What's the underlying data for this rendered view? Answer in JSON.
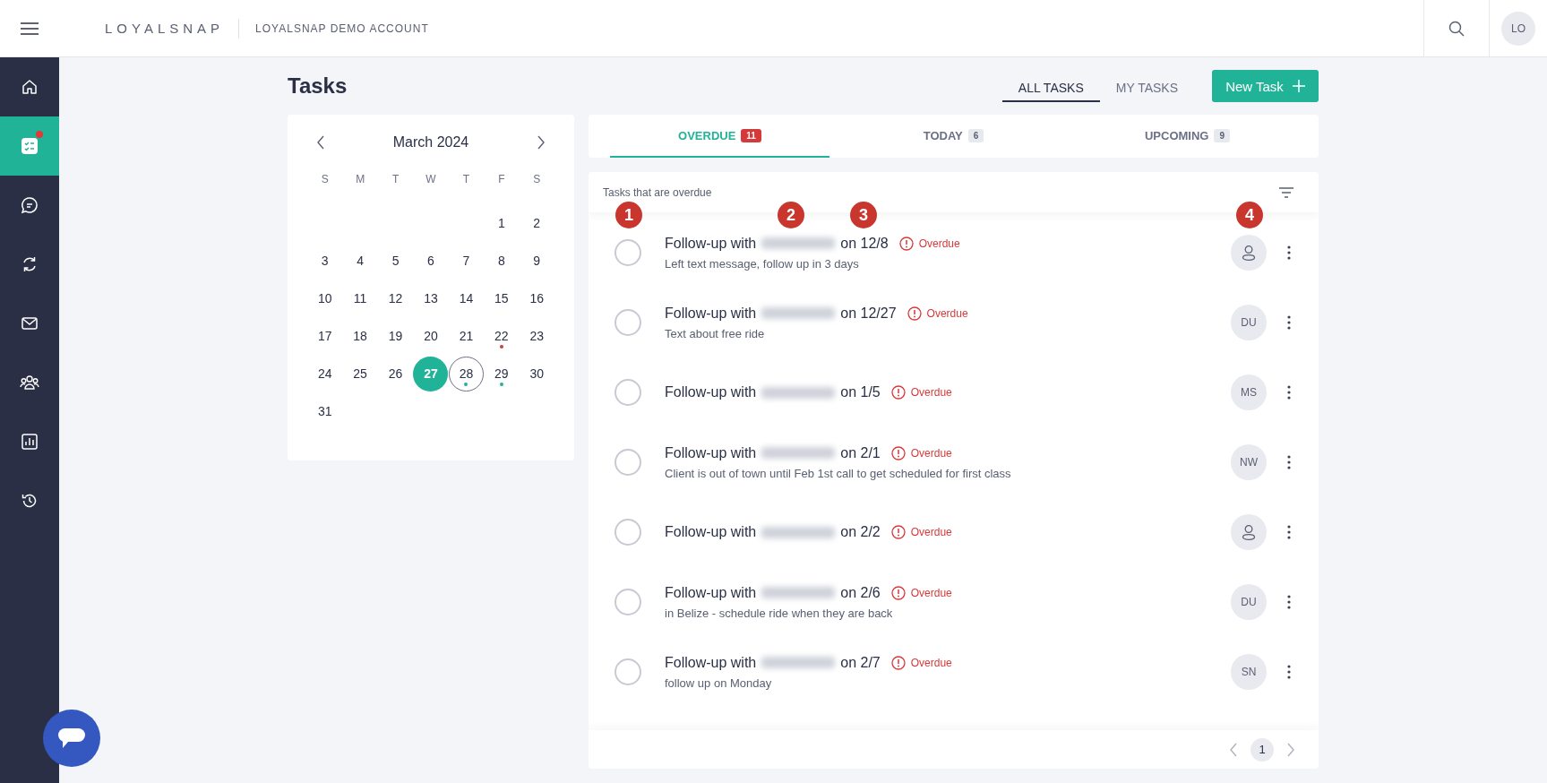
{
  "header": {
    "logo": "LOYALSNAP",
    "account": "LOYALSNAP DEMO ACCOUNT",
    "user_initials": "LO"
  },
  "sidebar": {
    "items": [
      {
        "kind": "home",
        "selected": false,
        "badge": false
      },
      {
        "kind": "tasks",
        "selected": true,
        "badge": true
      },
      {
        "kind": "chat",
        "selected": false,
        "badge": false
      },
      {
        "kind": "sync",
        "selected": false,
        "badge": false
      },
      {
        "kind": "mail",
        "selected": false,
        "badge": false
      },
      {
        "kind": "people",
        "selected": false,
        "badge": false
      },
      {
        "kind": "report",
        "selected": false,
        "badge": false
      },
      {
        "kind": "history",
        "selected": false,
        "badge": false
      }
    ]
  },
  "page": {
    "title": "Tasks"
  },
  "view_tabs": [
    {
      "label": "ALL TASKS",
      "selected": true
    },
    {
      "label": "MY TASKS",
      "selected": false
    }
  ],
  "new_task_button": {
    "label": "New Task"
  },
  "calendar": {
    "month": "March 2024",
    "weekdays": [
      "S",
      "M",
      "T",
      "W",
      "T",
      "F",
      "S"
    ],
    "days": [
      {
        "label": "1",
        "selected": false,
        "today": false
      },
      {
        "label": "2",
        "selected": false,
        "today": false
      },
      {
        "label": "3",
        "selected": false,
        "today": false
      },
      {
        "label": "4",
        "selected": false,
        "today": false
      },
      {
        "label": "5",
        "selected": false,
        "today": false
      },
      {
        "label": "6",
        "selected": false,
        "today": false
      },
      {
        "label": "7",
        "selected": false,
        "today": false
      },
      {
        "label": "8",
        "selected": false,
        "today": false
      },
      {
        "label": "9",
        "selected": false,
        "today": false
      },
      {
        "label": "10",
        "selected": false,
        "today": false
      },
      {
        "label": "11",
        "selected": false,
        "today": false
      },
      {
        "label": "12",
        "selected": false,
        "today": false
      },
      {
        "label": "13",
        "selected": false,
        "today": false
      },
      {
        "label": "14",
        "selected": false,
        "today": false
      },
      {
        "label": "15",
        "selected": false,
        "today": false
      },
      {
        "label": "16",
        "selected": false,
        "today": false
      },
      {
        "label": "17",
        "selected": false,
        "today": false
      },
      {
        "label": "18",
        "selected": false,
        "today": false
      },
      {
        "label": "19",
        "selected": false,
        "today": false
      },
      {
        "label": "20",
        "selected": false,
        "today": false
      },
      {
        "label": "21",
        "selected": false,
        "today": false
      },
      {
        "label": "22",
        "selected": false,
        "today": false,
        "color": "#d6393a"
      },
      {
        "label": "23",
        "selected": false,
        "today": false
      },
      {
        "label": "24",
        "selected": false,
        "today": false
      },
      {
        "label": "25",
        "selected": false,
        "today": false
      },
      {
        "label": "26",
        "selected": false,
        "today": false
      },
      {
        "label": "27",
        "selected": true,
        "today": false
      },
      {
        "label": "28",
        "selected": false,
        "today": true,
        "color": "#21b397"
      },
      {
        "label": "29",
        "selected": false,
        "today": false,
        "color": "#21b397"
      },
      {
        "label": "30",
        "selected": false,
        "today": false
      },
      {
        "label": "31",
        "selected": false,
        "today": false
      }
    ]
  },
  "task_tabs": [
    {
      "label": "OVERDUE",
      "count": "11",
      "kind": "alert",
      "selected": true
    },
    {
      "label": "TODAY",
      "count": "6",
      "kind": "plain",
      "selected": false
    },
    {
      "label": "UPCOMING",
      "count": "9",
      "kind": "plain",
      "selected": false
    }
  ],
  "task_list": {
    "heading": "Tasks that are overdue",
    "annotations": [
      "1",
      "2",
      "3",
      "4"
    ],
    "tasks": [
      {
        "checked": false,
        "title": "Follow-up with",
        "date": "on 12/8",
        "status": "Overdue",
        "note": "Left text message, follow up in 3 days",
        "assignee": {
          "kind": "unassigned"
        }
      },
      {
        "checked": false,
        "title": "Follow-up with",
        "date": "on 12/27",
        "status": "Overdue",
        "note": "Text about free ride",
        "assignee": {
          "kind": "initials",
          "initials": "DU"
        }
      },
      {
        "checked": false,
        "title": "Follow-up with",
        "date": "on 1/5",
        "status": "Overdue",
        "assignee": {
          "kind": "initials",
          "initials": "MS"
        }
      },
      {
        "checked": false,
        "title": "Follow-up with",
        "date": "on 2/1",
        "status": "Overdue",
        "note": "Client is out of town until Feb 1st call to get scheduled for first class",
        "assignee": {
          "kind": "initials",
          "initials": "NW"
        }
      },
      {
        "checked": false,
        "title": "Follow-up with",
        "date": "on 2/2",
        "status": "Overdue",
        "assignee": {
          "kind": "unassigned"
        }
      },
      {
        "checked": false,
        "title": "Follow-up with",
        "date": "on 2/6",
        "status": "Overdue",
        "note": "in Belize - schedule ride when they are back",
        "assignee": {
          "kind": "initials",
          "initials": "DU"
        }
      },
      {
        "checked": false,
        "title": "Follow-up with",
        "date": "on 2/7",
        "status": "Overdue",
        "note": "follow up on Monday",
        "assignee": {
          "kind": "initials",
          "initials": "SN"
        }
      }
    ],
    "pages": [
      {
        "label": "1",
        "selected": true
      }
    ]
  }
}
